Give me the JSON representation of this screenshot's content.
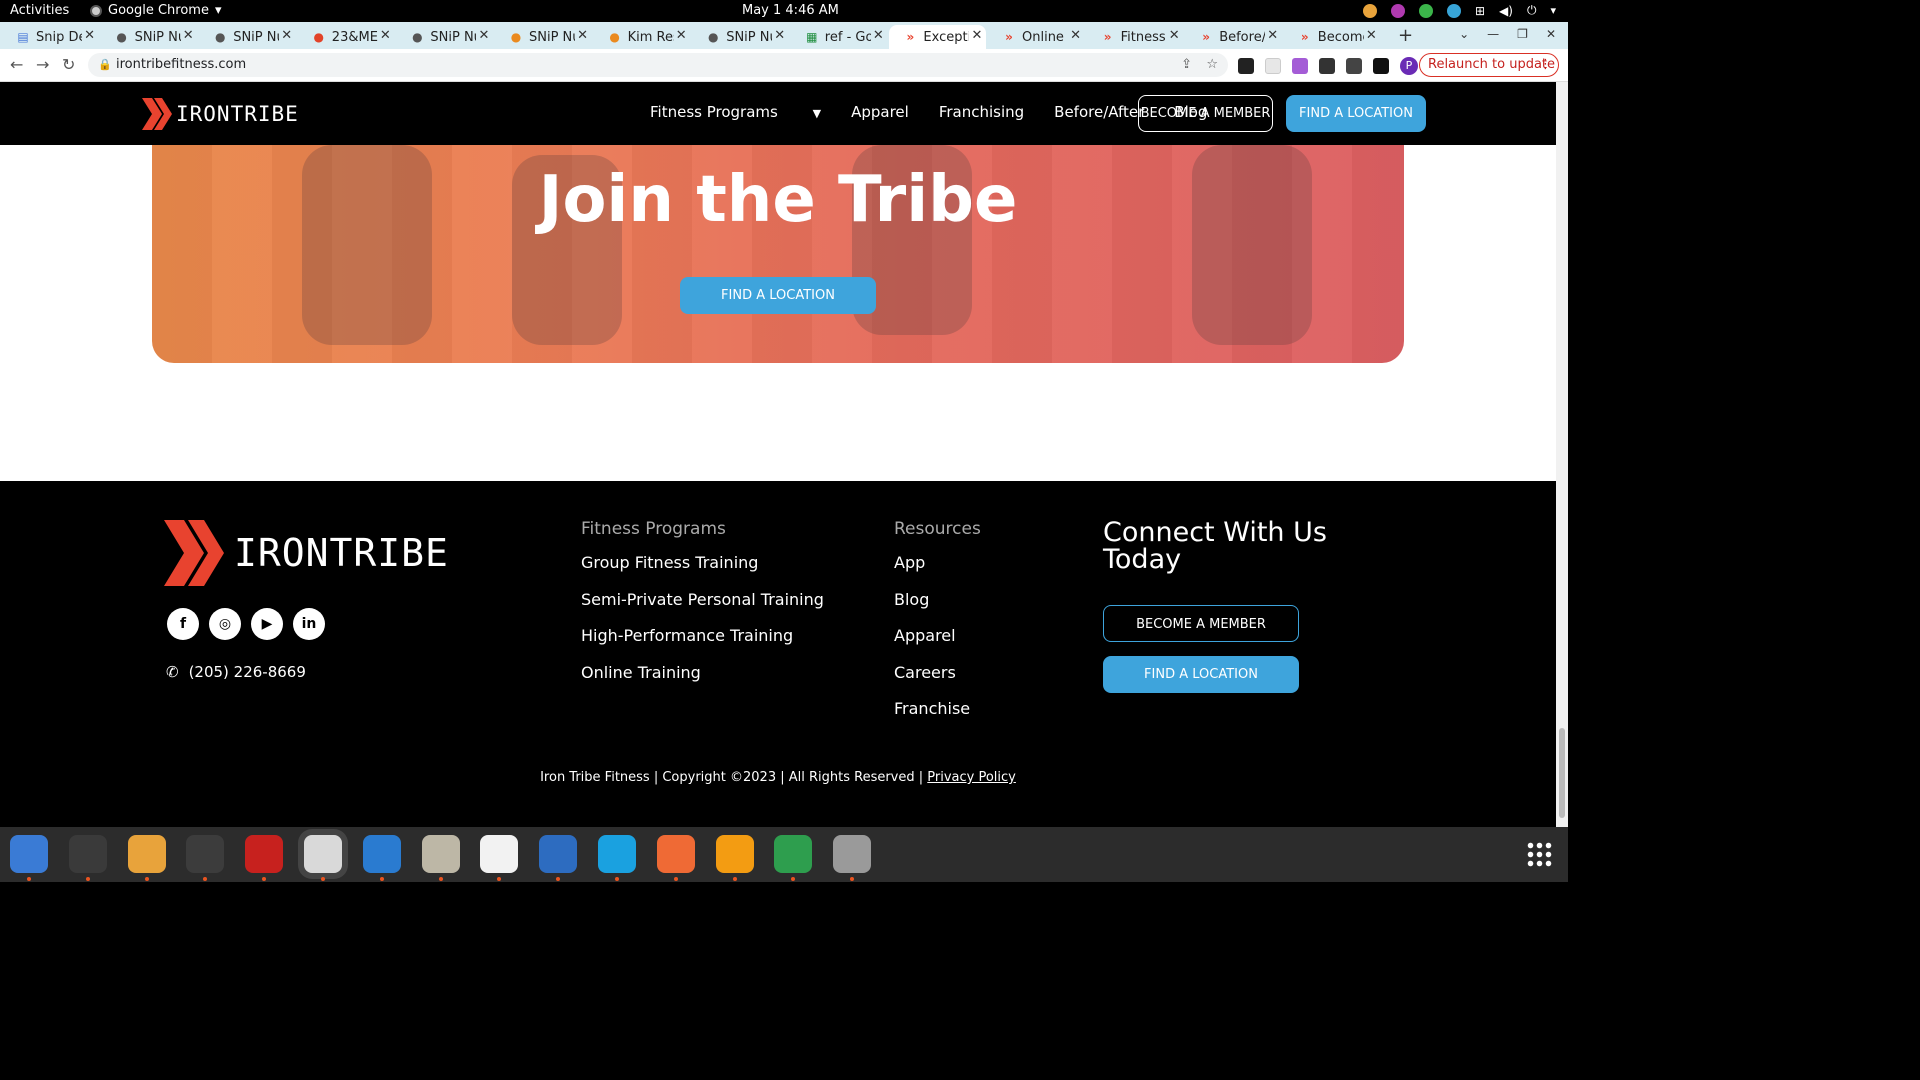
{
  "topbar": {
    "activities": "Activities",
    "app_name": "Google Chrome",
    "clock": "May 1  4:46 AM"
  },
  "tabs": [
    {
      "title": "Snip Det",
      "icon": "docs-icon",
      "color": "#4a7ad8"
    },
    {
      "title": "SNiP Nu",
      "icon": "snip-icon",
      "color": "#555555"
    },
    {
      "title": "SNiP Nu",
      "icon": "snip-icon",
      "color": "#555555"
    },
    {
      "title": "23&ME",
      "icon": "gitlab-icon",
      "color": "#e24329"
    },
    {
      "title": "SNiP Nu",
      "icon": "snip-icon",
      "color": "#555555"
    },
    {
      "title": "SNiP Nu",
      "icon": "google-icon",
      "color": "#ea8a1f"
    },
    {
      "title": "Kim Res",
      "icon": "google-icon",
      "color": "#ea8a1f"
    },
    {
      "title": "SNiP Nu",
      "icon": "snip-icon",
      "color": "#555555"
    },
    {
      "title": "ref - Goo",
      "icon": "sheets-icon",
      "color": "#1e8e3e"
    },
    {
      "title": "Exceptio",
      "icon": "irontribe-icon",
      "color": "#e8432f"
    },
    {
      "title": "Online T",
      "icon": "irontribe-icon",
      "color": "#e8432f"
    },
    {
      "title": "Fitness",
      "icon": "irontribe-icon",
      "color": "#e8432f"
    },
    {
      "title": "Before/",
      "icon": "irontribe-icon",
      "color": "#e8432f"
    },
    {
      "title": "Become",
      "icon": "irontribe-icon",
      "color": "#e8432f"
    }
  ],
  "address": {
    "url": "irontribefitness.com",
    "relaunch": "Relaunch to update",
    "profile_initial": "P"
  },
  "site": {
    "logo_text": "IRONTRIBE",
    "nav": [
      "Fitness Programs",
      "Apparel",
      "Franchising",
      "Before/After",
      "Blog"
    ],
    "become_member": "BECOME A MEMBER",
    "find_location": "FIND A LOCATION",
    "accent": "#3ea4dc",
    "brand": "#e8432f"
  },
  "hero": {
    "title": "Join the Tribe",
    "cta": "FIND A LOCATION"
  },
  "footer": {
    "logo_text": "IRONTRIBE",
    "social": [
      "facebook-icon",
      "instagram-icon",
      "youtube-icon",
      "linkedin-icon"
    ],
    "phone": "(205) 226-8669",
    "programs_head": "Fitness Programs",
    "programs": [
      "Group Fitness Training",
      "Semi-Private Personal Training",
      "High-Performance Training",
      "Online Training"
    ],
    "resources_head": "Resources",
    "resources": [
      "App",
      "Blog",
      "Apparel",
      "Careers",
      "Franchise"
    ],
    "connect_title": "Connect With Us Today",
    "become_member": "BECOME A MEMBER",
    "find_location": "FIND A LOCATION",
    "copyright": "Iron Tribe Fitness | Copyright ©2023 | All Rights Reserved | ",
    "privacy": "Privacy Policy"
  },
  "dock": [
    "thunderbird",
    "terminal",
    "calculator",
    "system-monitor",
    "filezilla",
    "chrome",
    "vscode",
    "files",
    "text-editor",
    "libreoffice-writer",
    "skype",
    "postman",
    "firefox-dev",
    "libreoffice-calc",
    "disks"
  ]
}
